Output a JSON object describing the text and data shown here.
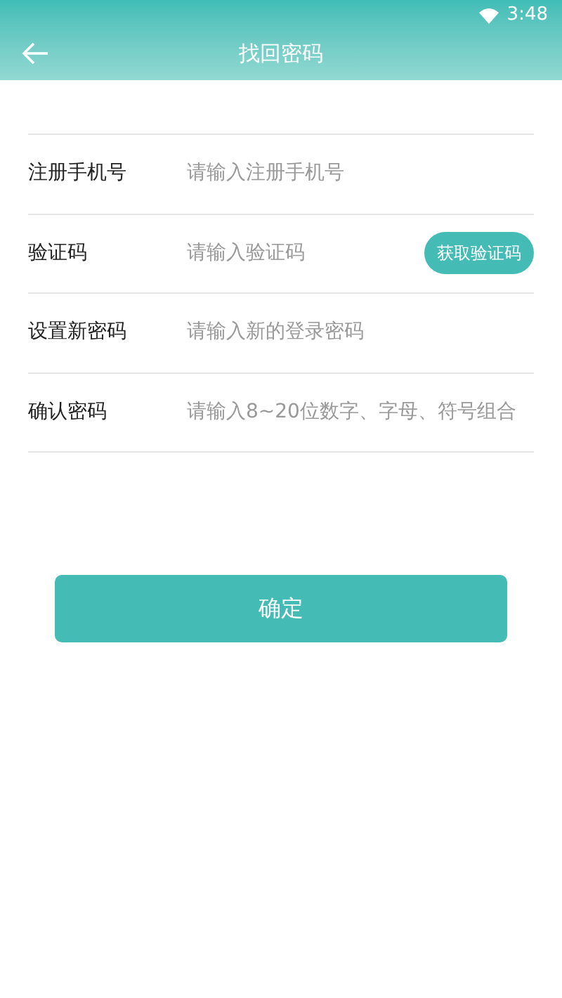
{
  "status_bar": {
    "time": "3:48"
  },
  "header": {
    "title": "找回密码"
  },
  "fields": [
    {
      "label": "注册手机号",
      "placeholder": "请输入注册手机号"
    },
    {
      "label": "验证码",
      "placeholder": "请输入验证码",
      "action": "获取验证码"
    },
    {
      "label": "设置新密码",
      "placeholder": "请输入新的登录密码"
    },
    {
      "label": "确认密码",
      "placeholder": "请输入8~20位数字、字母、符号组合"
    }
  ],
  "submit": "确定"
}
